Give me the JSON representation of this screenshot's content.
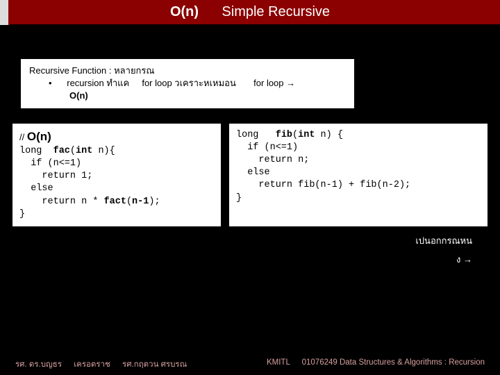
{
  "title": {
    "left": "O(n)",
    "right": "Simple Recursive"
  },
  "desc": {
    "line1": "Recursive Function : หลายกรณ",
    "bullet_prefix": "•",
    "line2a": "recursion ทำแค",
    "line2b": "for loop  วเคราะหเหมอน",
    "line2c": "for loop →",
    "line3": "O(n)"
  },
  "code_left": {
    "l0a": "// ",
    "l0b": "O(n)",
    "l1": "long  fac(int n){",
    "l2": "  if (n<=1)",
    "l3": "    return 1;",
    "l4": "  else",
    "l5": "    return n * fact(n-1);",
    "l6": "}"
  },
  "code_right": {
    "l1": "long   fib(int n) {",
    "l2": "  if (n<=1)",
    "l3": "    return n;",
    "l4": "  else",
    "l5": "    return fib(n-1) + fib(n-2);",
    "l6": "}"
  },
  "notes": {
    "n1": "เปนอกกรณหน",
    "n2": "ง →"
  },
  "footer": {
    "left1": "รศ. ดร.บญธร",
    "left2": "เครอตราช",
    "left3": "รศ.กฤตวน  ศรบรณ",
    "right1": "KMITL",
    "right2": "01076249 Data Structures & Algorithms : Recursion"
  }
}
